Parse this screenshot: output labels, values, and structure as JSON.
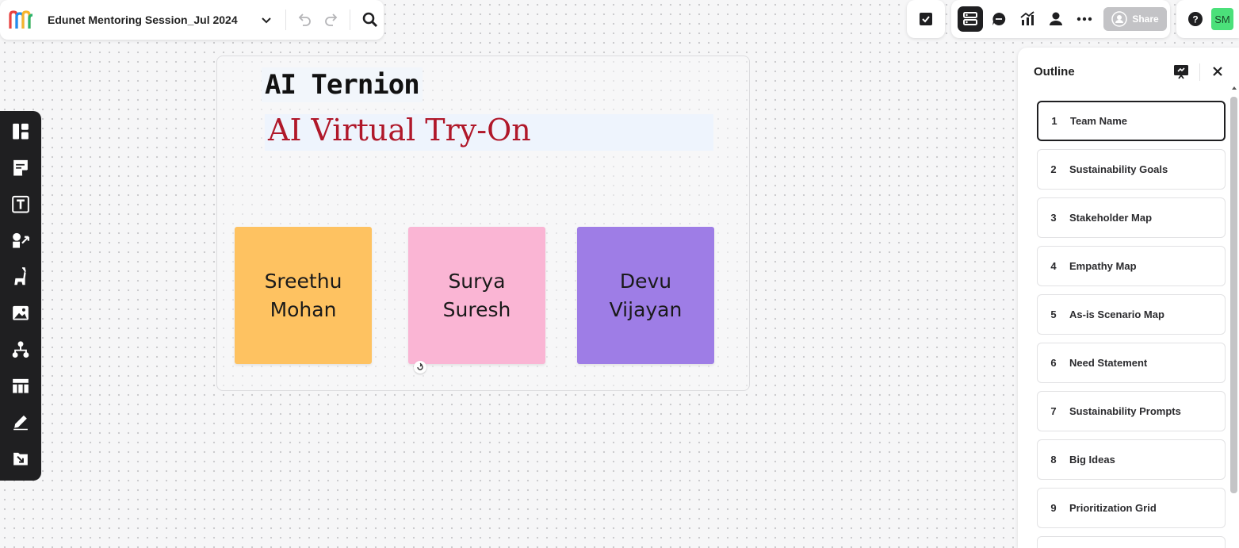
{
  "header": {
    "board_title": "Edunet Mentoring Session_Jul 2024",
    "share_label": "Share",
    "avatar_initials": "SM"
  },
  "canvas": {
    "team_name": "AI Ternion",
    "project_title": "AI Virtual Try-On",
    "stickies": [
      {
        "text": "Sreethu Mohan",
        "color": "#fec261"
      },
      {
        "text": "Surya Suresh",
        "color": "#fab5d4"
      },
      {
        "text": "Devu Vijayan",
        "color": "#9e7de6"
      }
    ]
  },
  "left_toolbar": {
    "tools": [
      "templates-icon",
      "sticky-note-icon",
      "text-icon",
      "shapes-icon",
      "llama-icon",
      "image-icon",
      "diagram-icon",
      "table-icon",
      "pen-icon",
      "import-icon"
    ]
  },
  "outline": {
    "title": "Outline",
    "items": [
      {
        "num": "1",
        "label": "Team Name"
      },
      {
        "num": "2",
        "label": "Sustainability Goals"
      },
      {
        "num": "3",
        "label": "Stakeholder Map"
      },
      {
        "num": "4",
        "label": "Empathy Map"
      },
      {
        "num": "5",
        "label": "As-is Scenario Map"
      },
      {
        "num": "6",
        "label": "Need Statement"
      },
      {
        "num": "7",
        "label": "Sustainability Prompts"
      },
      {
        "num": "8",
        "label": "Big Ideas"
      },
      {
        "num": "9",
        "label": "Prioritization Grid"
      }
    ]
  },
  "colors": {
    "accent": "#1f1f21",
    "project_title": "#b0182a",
    "avatar": "#4be07a"
  }
}
